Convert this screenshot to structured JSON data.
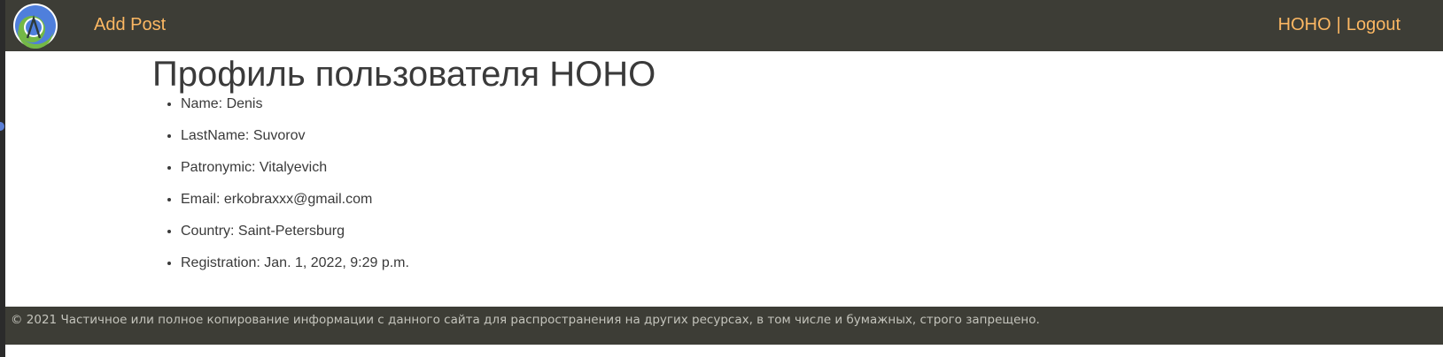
{
  "navbar": {
    "logo_icon": "site-logo-icon",
    "add_post_label": "Add Post",
    "username_label": "HOHO",
    "separator": "|",
    "logout_label": "Logout",
    "link_color": "#fdb863",
    "background_color": "#3d3d36"
  },
  "main": {
    "title": "Профиль пользователя HOHO",
    "fields": [
      "Name: Denis",
      "LastName: Suvorov",
      "Patronymic: Vitalyevich",
      "Email: erkobraxxx@gmail.com",
      "Country: Saint-Petersburg",
      "Registration: Jan. 1, 2022, 9:29 p.m."
    ]
  },
  "footer": {
    "text": "© 2021 Частичное или полное копирование информации с данного сайта для распространения на других ресурсах, в том числе и бумажных, строго запрещено."
  }
}
